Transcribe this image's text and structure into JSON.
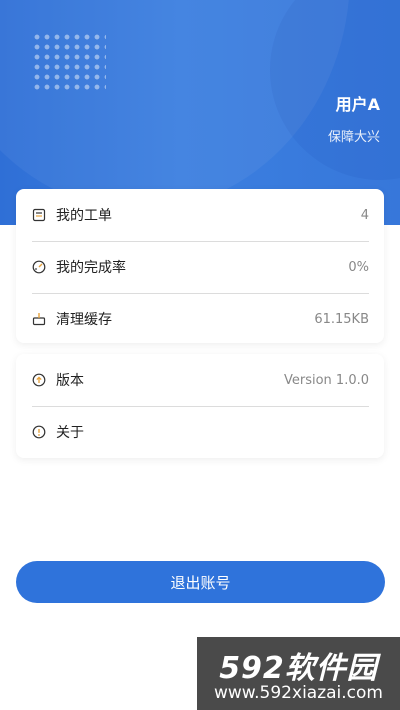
{
  "header": {
    "username": "用户A",
    "company": "保障大兴"
  },
  "card1": {
    "items": [
      {
        "label": "我的工单",
        "value": "4",
        "icon": "clipboard-icon"
      },
      {
        "label": "我的完成率",
        "value": "0%",
        "icon": "gauge-icon"
      },
      {
        "label": "清理缓存",
        "value": "61.15KB",
        "icon": "cleanup-icon"
      }
    ]
  },
  "card2": {
    "items": [
      {
        "label": "版本",
        "value": "Version 1.0.0",
        "icon": "version-icon"
      },
      {
        "label": "关于",
        "value": "",
        "icon": "info-icon"
      }
    ]
  },
  "logout_label": "退出账号",
  "watermark": {
    "brand": "592软件园",
    "url": "www.592xiazai.com"
  },
  "colors": {
    "primary": "#2f73db",
    "icon_accent": "#e6a23c"
  }
}
